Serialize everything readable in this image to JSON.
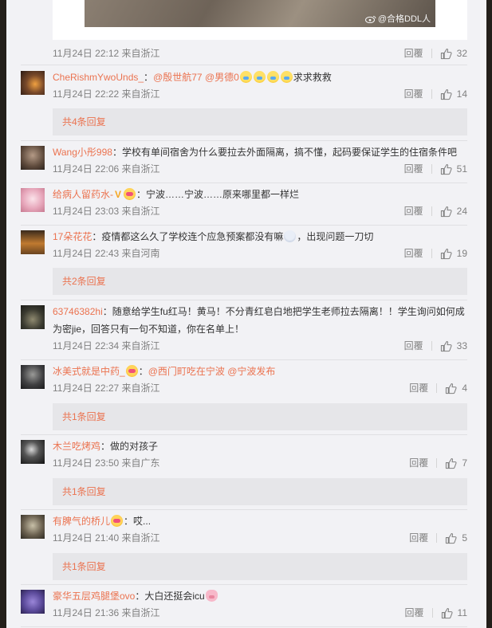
{
  "watermark": "@合格DDL人",
  "top_comment_meta": {
    "time": "11月24日 22:12 来自浙江",
    "reply": "回覆",
    "likes": "32"
  },
  "comments": [
    {
      "user": "CheRishmYwoUnds_",
      "sep": "：",
      "mentions": [
        "@殷世航77",
        "@男德0"
      ],
      "tail": "求求救救",
      "time": "11月24日 22:22 来自浙江",
      "reply": "回覆",
      "likes": "14",
      "avatar_color": "#5a3a2a",
      "sub_replies": "共4条回复"
    },
    {
      "user": "Wang小彤998",
      "sep": "：",
      "text": "学校有单间宿舍为什么要拉去外面隔离，搞不懂，起码要保证学生的住宿条件吧",
      "time": "11月24日 22:06 来自浙江",
      "reply": "回覆",
      "likes": "51",
      "avatar_color": "#7a6a5c"
    },
    {
      "user": "给病人留药水-",
      "sep": "：",
      "text": "宁波……宁波……原来哪里都一样烂",
      "time": "11月24日 23:03 来自浙江",
      "reply": "回覆",
      "likes": "24",
      "avatar_color": "#d9a7b8"
    },
    {
      "user": "17朵花花",
      "sep": "：",
      "text": "疫情都这么久了学校连个应急预案都没有嘛",
      "tail": "，出现问题一刀切",
      "time": "11月24日 22:43 来自河南",
      "reply": "回覆",
      "likes": "19",
      "avatar_color": "#8a5a2a",
      "sub_replies": "共2条回复"
    },
    {
      "user": "63746382hi",
      "sep": "：",
      "text": "随意给学生fu红马！黄马！不分青红皂白地把学生老师拉去隔离！！学生询问如何成为密jie，回答只有一句不知道，你在名单上！",
      "time": "11月24日 22:34 来自浙江",
      "reply": "回覆",
      "likes": "33",
      "avatar_color": "#3a3a36"
    },
    {
      "user": "冰美式就是中药_",
      "sep": "：",
      "mentions": [
        "@西门町吃在宁波",
        "@宁波发布"
      ],
      "time": "11月24日 22:27 来自浙江",
      "reply": "回覆",
      "likes": "4",
      "avatar_color": "#2e2e30",
      "sub_replies": "共1条回复"
    },
    {
      "user": "木兰吃烤鸡",
      "sep": "：",
      "text": "做的对孩子",
      "time": "11月24日 23:50 来自广东",
      "reply": "回覆",
      "likes": "7",
      "avatar_color": "#2a2a2a",
      "sub_replies": "共1条回复"
    },
    {
      "user": "有脾气的桥儿",
      "sep": "：",
      "text": "哎...",
      "time": "11月24日 21:40 来自浙江",
      "reply": "回覆",
      "likes": "5",
      "avatar_color": "#6b6150",
      "sub_replies": "共1条回复"
    },
    {
      "user": "豪华五层鸡腿堡ovo",
      "sep": "：",
      "text": "大白还挺会icu",
      "time": "11月24日 21:36 来自浙江",
      "reply": "回覆",
      "likes": "11",
      "avatar_color": "#5b4a9a"
    }
  ],
  "icons": {
    "like": "thumbs-up-icon",
    "weibo": "weibo-logo-icon"
  },
  "colors": {
    "username": "#eb7350",
    "meta": "#808080",
    "panel": "#f2f2f5",
    "subreply_bg": "#e6e6e9"
  }
}
